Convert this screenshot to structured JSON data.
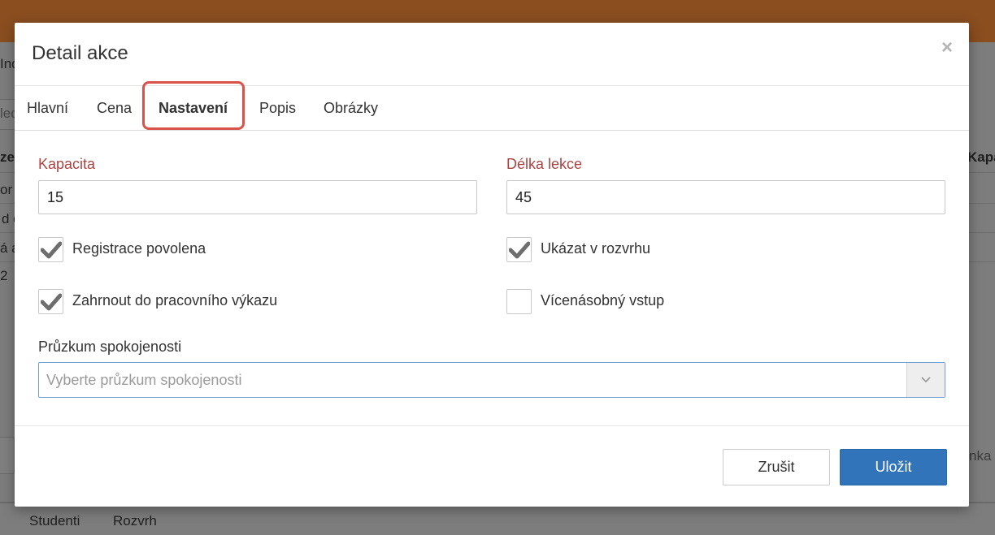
{
  "background": {
    "fragments": [
      "Ind",
      "led",
      "zev",
      "or",
      "d d",
      "á a",
      "2",
      "Kapa",
      "nka"
    ],
    "tabs": [
      "Studenti",
      "Rozvrh"
    ]
  },
  "modal": {
    "title": "Detail akce",
    "close_glyph": "×",
    "tabs": [
      {
        "label": "Hlavní"
      },
      {
        "label": "Cena"
      },
      {
        "label": "Nastavení"
      },
      {
        "label": "Popis"
      },
      {
        "label": "Obrázky"
      }
    ],
    "active_tab": "Nastavení",
    "fields": {
      "capacity": {
        "label": "Kapacita",
        "value": "15"
      },
      "lesson_length": {
        "label": "Délka lekce",
        "value": "45"
      }
    },
    "checkboxes": [
      {
        "label": "Registrace povolena",
        "checked": true
      },
      {
        "label": "Ukázat v rozvrhu",
        "checked": true
      },
      {
        "label": "Zahrnout do pracovního výkazu",
        "checked": true
      },
      {
        "label": "Vícenásobný vstup",
        "checked": false
      }
    ],
    "survey": {
      "label": "Průzkum spokojenosti",
      "placeholder": "Vyberte průzkum spokojenosti"
    },
    "buttons": {
      "cancel": "Zrušit",
      "save": "Uložit"
    }
  },
  "colors": {
    "header_bar": "#8a4e1f",
    "required_label": "#a94442",
    "primary_button": "#3174b9",
    "tab_highlight": "#d9534a"
  }
}
